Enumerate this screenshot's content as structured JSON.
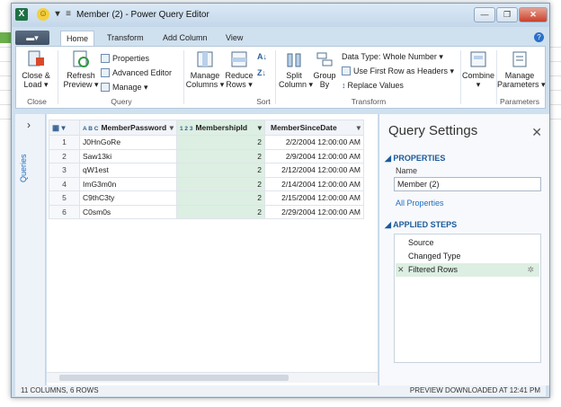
{
  "window": {
    "title": "Member (2) - Power Query Editor"
  },
  "tabs": [
    {
      "label": "Home",
      "active": true
    },
    {
      "label": "Transform"
    },
    {
      "label": "Add Column"
    },
    {
      "label": "View"
    }
  ],
  "file_tab": "▬▾",
  "ribbon": {
    "close_load": "Close &\nLoad ▾",
    "refresh_preview": "Refresh\nPreview ▾",
    "properties": "Properties",
    "advanced_editor": "Advanced Editor",
    "manage": "Manage ▾",
    "manage_columns": "Manage\nColumns ▾",
    "reduce_rows": "Reduce\nRows ▾",
    "split_column": "Split\nColumn ▾",
    "group_by": "Group\nBy",
    "data_type": "Data Type: Whole Number ▾",
    "first_row_headers": "Use First Row as Headers ▾",
    "replace_values": "Replace Values",
    "combine": "Combine\n▾",
    "manage_parameters": "Manage\nParameters ▾",
    "groups": {
      "close": "Close",
      "query": "Query",
      "sort": "Sort",
      "transform": "Transform",
      "parameters": "Parameters"
    }
  },
  "queries_pane": {
    "label": "Queries"
  },
  "grid": {
    "columns": [
      {
        "type": "A B C",
        "name": "MemberPassword"
      },
      {
        "type": "1 2 3",
        "name": "MembershipId"
      },
      {
        "type": "",
        "name": "MemberSinceDate"
      }
    ],
    "rows": [
      [
        "1",
        "J0HnGoRe",
        "2",
        "2/2/2004 12:00:00 AM"
      ],
      [
        "2",
        "Saw13ki",
        "2",
        "2/9/2004 12:00:00 AM"
      ],
      [
        "3",
        "qW1est",
        "2",
        "2/12/2004 12:00:00 AM"
      ],
      [
        "4",
        "ImG3m0n",
        "2",
        "2/14/2004 12:00:00 AM"
      ],
      [
        "5",
        "C9thC3ty",
        "2",
        "2/15/2004 12:00:00 AM"
      ],
      [
        "6",
        "C0sm0s",
        "2",
        "2/29/2004 12:00:00 AM"
      ]
    ]
  },
  "settings": {
    "title": "Query Settings",
    "properties_header": "PROPERTIES",
    "name_label": "Name",
    "name_value": "Member (2)",
    "all_properties": "All Properties",
    "steps_header": "APPLIED STEPS",
    "steps": [
      "Source",
      "Changed Type",
      "Filtered Rows"
    ]
  },
  "status": {
    "left": "11 COLUMNS, 6 ROWS",
    "right": "PREVIEW DOWNLOADED AT 12:41 PM"
  }
}
